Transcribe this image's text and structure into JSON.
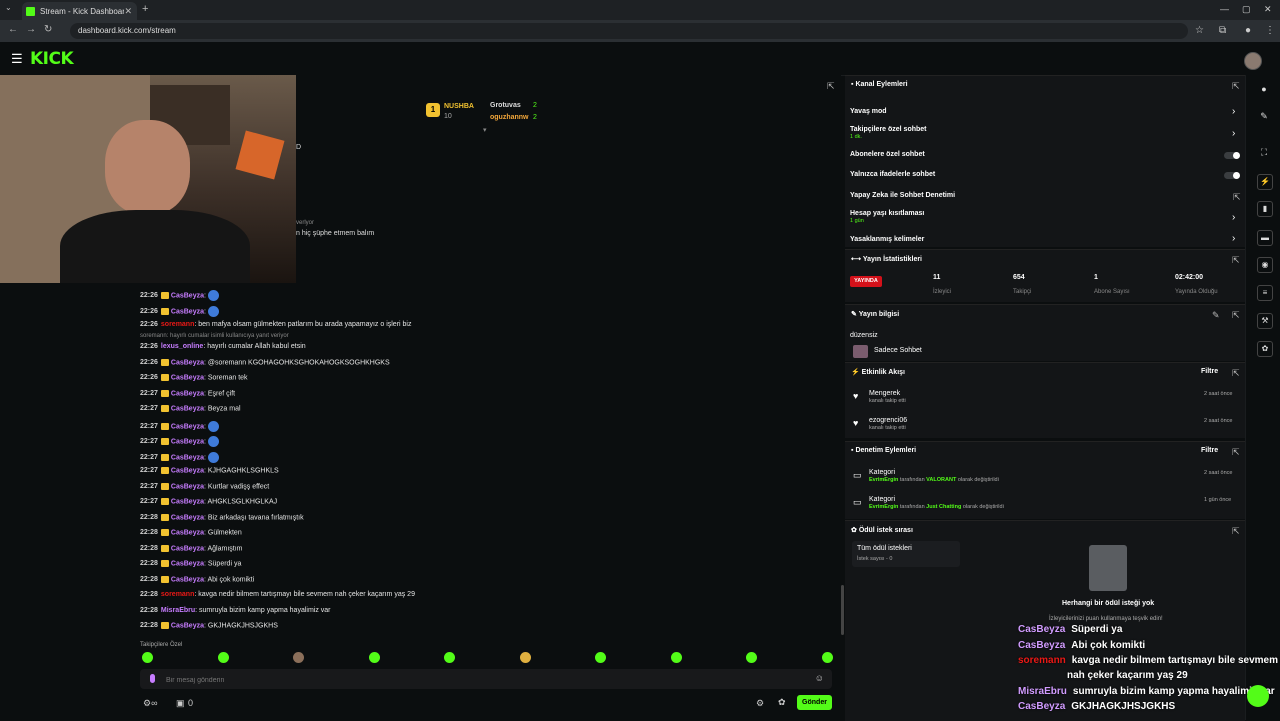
{
  "browser": {
    "tab_title": "Stream - Kick Dashboard",
    "url": "dashboard.kick.com/stream"
  },
  "header": {
    "logo": "KICK"
  },
  "prediction": {
    "rank": "1",
    "leader_name": "NUSHBA",
    "leader_value": "10",
    "p2_name": "Grotuvas",
    "p2_value": "2",
    "p3_name": "oguzhannw",
    "p3_value": "2"
  },
  "chat_partial": {
    "fragment1": "D",
    "fragment2": "verlyor",
    "fragment3": "n hiç şüphe etmem balım"
  },
  "chat": [
    {
      "time": "22:26",
      "user": "CasBeyza",
      "msg": "",
      "emote": true
    },
    {
      "time": "22:26",
      "user": "CasBeyza",
      "msg": "",
      "emote": true
    },
    {
      "time": "22:26",
      "user": "soremann",
      "msg": ": ben mafya olsam gülmekten patlarım bu arada yapamayız o işleri biz",
      "red": true
    },
    {
      "time": "",
      "user": "",
      "msg": "soremann: hayırlı cumalar isimli kullanıcıya yanıt veriyor",
      "reply": true
    },
    {
      "time": "22:26",
      "user": "lexus_online",
      "msg": ": hayırlı cumalar Allah kabul etsin"
    },
    {
      "time": "22:26",
      "user": "CasBeyza",
      "msg": ": @soremann KGOHAGOHKSGHOKAHOGKSOGHKHGKS"
    },
    {
      "time": "22:26",
      "user": "CasBeyza",
      "msg": ": Soreman tek"
    },
    {
      "time": "22:27",
      "user": "CasBeyza",
      "msg": ": Eşref çift"
    },
    {
      "time": "22:27",
      "user": "CasBeyza",
      "msg": ": Beyza mal"
    },
    {
      "time": "22:27",
      "user": "CasBeyza",
      "msg": "",
      "emote": true
    },
    {
      "time": "22:27",
      "user": "CasBeyza",
      "msg": "",
      "emote": true
    },
    {
      "time": "22:27",
      "user": "CasBeyza",
      "msg": "",
      "emote": true
    },
    {
      "time": "22:27",
      "user": "CasBeyza",
      "msg": ": KJHGAGHKLSGHKLS"
    },
    {
      "time": "22:27",
      "user": "CasBeyza",
      "msg": ": Kurtlar vadişş effect"
    },
    {
      "time": "22:27",
      "user": "CasBeyza",
      "msg": ": AHGKLSGLKHGLKAJ"
    },
    {
      "time": "22:28",
      "user": "CasBeyza",
      "msg": ": Biz arkadaşı tavana fırlatmıştık"
    },
    {
      "time": "22:28",
      "user": "CasBeyza",
      "msg": ": Gülmekten"
    },
    {
      "time": "22:28",
      "user": "CasBeyza",
      "msg": ": Ağlamıştım"
    },
    {
      "time": "22:28",
      "user": "CasBeyza",
      "msg": ": Süperdi ya"
    },
    {
      "time": "22:28",
      "user": "CasBeyza",
      "msg": ": Abi çok komikti"
    },
    {
      "time": "22:28",
      "user": "soremann",
      "msg": ": kavga nedir bilmem tartışmayı bile sevmem nah çeker kaçarım yaş 29",
      "red": true
    },
    {
      "time": "22:28",
      "user": "MisraEbru",
      "msg": ": sumruyla bizim kamp yapma hayalimiz var"
    },
    {
      "time": "22:28",
      "user": "CasBeyza",
      "msg": ": GKJHAGKJHSJGKHS"
    }
  ],
  "followers_only": "Takipçilere Özel",
  "message_placeholder": "Bir mesaj gönderin",
  "send_label": "Gönder",
  "bottom_count": "0",
  "channel_actions": {
    "title": "Kanal Eylemleri",
    "slow_mode": "Yavaş mod",
    "followers_chat": "Takipçilere özel sohbet",
    "followers_chat_sub": "1 dk.",
    "subs_chat": "Abonelere özel sohbet",
    "emotes_chat": "Yalnızca ifadelerle sohbet",
    "ai_moderation": "Yapay Zeka ile Sohbet Denetimi",
    "account_age": "Hesap yaşı kısıtlaması",
    "account_age_sub": "1 gün",
    "banned_words": "Yasaklanmış kelimeler"
  },
  "stream_stats": {
    "title": "Yayın İstatistikleri",
    "live": "YAYINDA",
    "viewers": "11",
    "viewers_label": "İzleyici",
    "followers": "654",
    "followers_label": "Takipçi",
    "subs": "1",
    "subs_label": "Abone Sayısı",
    "uptime": "02:42:00",
    "uptime_label": "Yayında Olduğu"
  },
  "stream_info": {
    "title": "Yayın bilgisi",
    "stream_title": "düzensiz",
    "category": "Sadece Sohbet"
  },
  "activity": {
    "title": "Etkinlik Akışı",
    "filter": "Filtre",
    "items": [
      {
        "name": "Mengerek",
        "sub": "kanalı takip etti",
        "ago": "2 saat önce"
      },
      {
        "name": "ezogrenci06",
        "sub": "kanalı takip etti",
        "ago": "2 saat önce"
      }
    ]
  },
  "mod_actions": {
    "title": "Denetim Eylemleri",
    "filter": "Filtre",
    "items": [
      {
        "name": "Kategori",
        "by": "EvrimErgin",
        "mid": " tarafından ",
        "val": "VALORANT",
        "end": " olarak değiştirildi",
        "ago": "2 saat önce"
      },
      {
        "name": "Kategori",
        "by": "EvrimErgin",
        "mid": " tarafından ",
        "val": "Just Chatting",
        "end": " olarak değiştirildi",
        "ago": "1 gün önce"
      }
    ]
  },
  "rewards": {
    "title": "Ödül istek sırası",
    "all": "Tüm ödül istekleri",
    "count": "İstek sayısı - 0",
    "empty_title": "Herhangi bir ödül isteği yok",
    "empty_sub": "İzleyicilerinizi puan kullanmaya teşvik edin!"
  },
  "overlay_chat": [
    {
      "name": "CasBeyza",
      "msg": "Süperdi ya"
    },
    {
      "name": "CasBeyza",
      "msg": "Abi çok komikti"
    },
    {
      "name": "soremann",
      "msg": "kavga nedir bilmem tartışmayı bile sevmem",
      "red": true
    },
    {
      "name": "",
      "msg": "nah çeker kaçarım yaş 29"
    },
    {
      "name": "MisraEbru",
      "msg": "sumruyla bizim kamp yapma hayalimiz var"
    },
    {
      "name": "CasBeyza",
      "msg": "GKJHAGKJHSJGKHS"
    }
  ],
  "colors": {
    "brand": "#53fc18",
    "live": "#d4111a",
    "username": "#c77dff",
    "red_user": "#e91916"
  }
}
